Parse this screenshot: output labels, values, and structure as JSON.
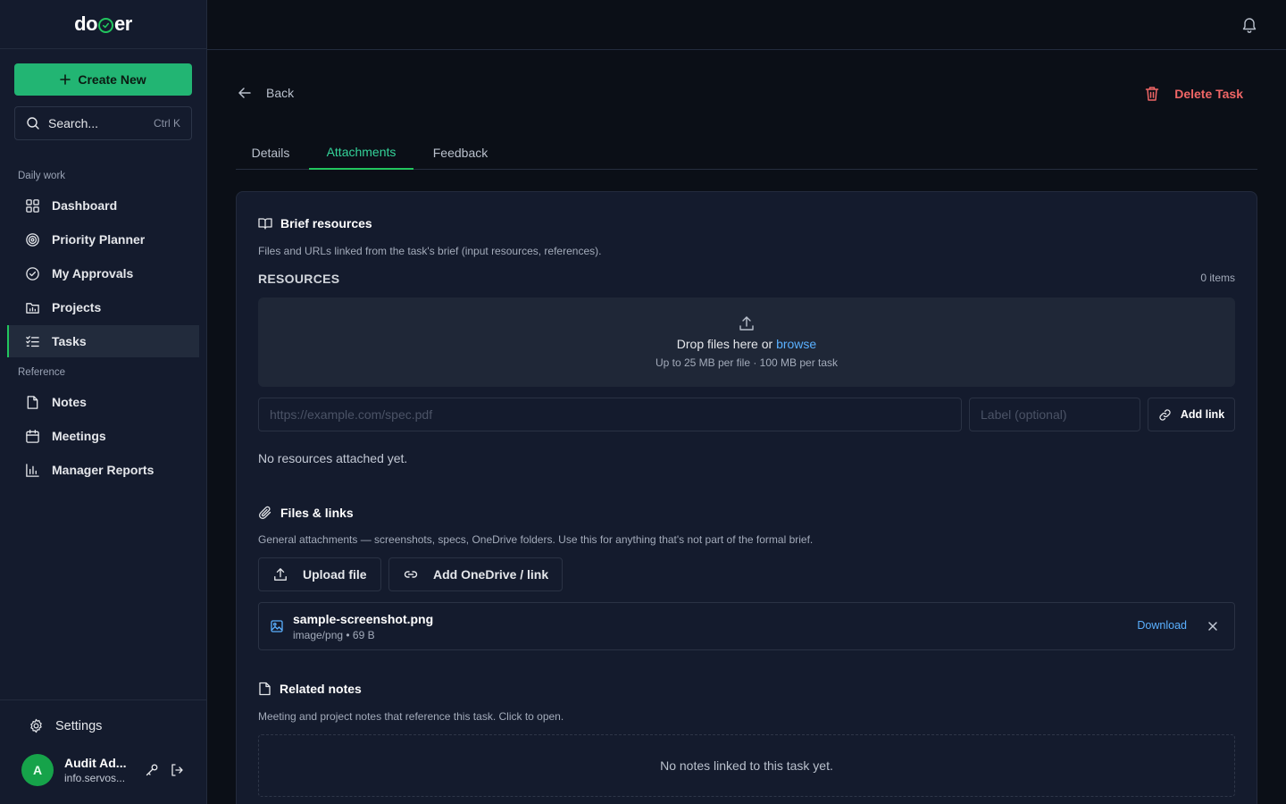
{
  "app": {
    "logo_left": "do",
    "logo_right": "er"
  },
  "sidebar": {
    "create_label": "Create New",
    "search_placeholder": "Search...",
    "search_shortcut": "Ctrl K",
    "section_daily": "Daily work",
    "section_reference": "Reference",
    "items": [
      {
        "label": "Dashboard",
        "icon": "grid-icon"
      },
      {
        "label": "Priority Planner",
        "icon": "target-icon"
      },
      {
        "label": "My Approvals",
        "icon": "check-circle-icon"
      },
      {
        "label": "Projects",
        "icon": "folder-chart-icon"
      },
      {
        "label": "Tasks",
        "icon": "checklist-icon",
        "active": true
      },
      {
        "label": "Notes",
        "icon": "file-icon"
      },
      {
        "label": "Meetings",
        "icon": "calendar-icon"
      },
      {
        "label": "Manager Reports",
        "icon": "bar-chart-icon"
      }
    ],
    "settings_label": "Settings",
    "user": {
      "initial": "A",
      "name": "Audit Ad...",
      "email": "info.servos..."
    }
  },
  "header": {
    "back_label": "Back",
    "delete_label": "Delete Task"
  },
  "tabs": [
    {
      "label": "Details",
      "active": false
    },
    {
      "label": "Attachments",
      "active": true
    },
    {
      "label": "Feedback",
      "active": false
    }
  ],
  "brief": {
    "title": "Brief resources",
    "description": "Files and URLs linked from the task's brief (input resources, references).",
    "resources_label": "RESOURCES",
    "count": "0 items",
    "drop_text": "Drop files here or ",
    "browse_label": "browse",
    "limits": "Up to 25 MB per file · 100 MB per task",
    "url_placeholder": "https://example.com/spec.pdf",
    "label_placeholder": "Label (optional)",
    "add_link_label": "Add link",
    "empty_text": "No resources attached yet."
  },
  "files": {
    "title": "Files & links",
    "description": "General attachments — screenshots, specs, OneDrive folders. Use this for anything that's not part of the formal brief.",
    "upload_label": "Upload file",
    "onedrive_label": "Add OneDrive / link",
    "items": [
      {
        "name": "sample-screenshot.png",
        "meta": "image/png • 69 B",
        "download_label": "Download"
      }
    ]
  },
  "notes": {
    "title": "Related notes",
    "description": "Meeting and project notes that reference this task. Click to open.",
    "empty_text": "No notes linked to this task yet."
  },
  "colors": {
    "accent": "#22b573",
    "danger": "#f06666",
    "link": "#5ab0ff",
    "background": "#0b0f17",
    "surface": "#141b2d"
  }
}
